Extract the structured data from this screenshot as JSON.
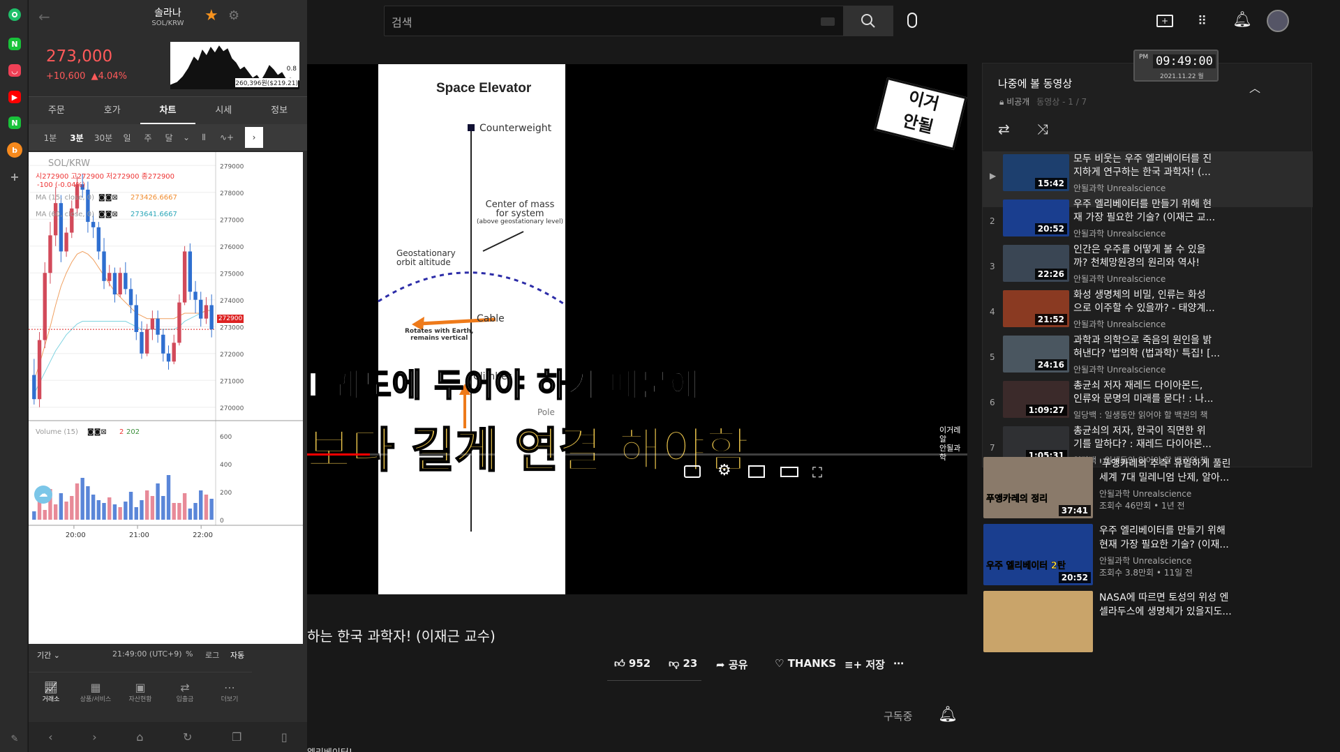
{
  "left_edge": {
    "icons": [
      "green-circle-icon",
      "naver-icon",
      "pocket-icon",
      "youtube-icon",
      "naver-icon",
      "upbit-icon",
      "add-icon",
      "pin-icon"
    ]
  },
  "upbit": {
    "coin_name": "솔라나",
    "pair": "SOL/KRW",
    "price": "273,000",
    "change": "+10,600",
    "change_pct": "▲4.04%",
    "mini_chart_labels": {
      "a": "0.8",
      "b": "260,396원($219.21)"
    },
    "tabs": [
      "주문",
      "호가",
      "차트",
      "시세",
      "정보"
    ],
    "active_tab": "차트",
    "intervals": [
      "1분",
      "3분",
      "30분",
      "일",
      "주",
      "달"
    ],
    "active_interval": "3분",
    "chart_title": "SOL/KRW",
    "ohlc": "시272900 고272900 저272900 종272900",
    "change_line": "-100 (-0.04%)",
    "ma15_label": "MA (15, close, 0)",
    "ma15_value": "273426.6667",
    "ma60_label": "MA (60, close, 0)",
    "ma60_value": "273641.6667",
    "current_price_tag": "272900",
    "y_ticks": [
      "279000",
      "278000",
      "277000",
      "276000",
      "275000",
      "274000",
      "273000",
      "272000",
      "271000",
      "270000"
    ],
    "volume_label": "Volume (15)",
    "volume_value": "2",
    "volume_value2": "202",
    "vol_ticks": [
      "600",
      "400",
      "200",
      "0"
    ],
    "x_ticks": [
      "20:00",
      "21:00",
      "22:00"
    ],
    "footer": {
      "period": "기간 ⌄",
      "time": "21:49:00 (UTC+9)",
      "pct": "%",
      "log": "로그",
      "auto": "자동"
    },
    "nav": [
      "거래소",
      "상품/서비스",
      "자산현황",
      "입출금",
      "더보기"
    ]
  },
  "chart_data": {
    "type": "candlestick",
    "title": "SOL/KRW",
    "ylim": [
      269500,
      279500
    ],
    "x_range": [
      "19:46",
      "22:16"
    ],
    "candles": [
      [
        271200,
        271800,
        270100,
        270300
      ],
      [
        270300,
        272800,
        270000,
        272500
      ],
      [
        272500,
        275400,
        272200,
        275000
      ],
      [
        275000,
        276900,
        274600,
        276400
      ],
      [
        276400,
        278200,
        276000,
        277600
      ],
      [
        277600,
        277900,
        275400,
        275800
      ],
      [
        275800,
        276700,
        275600,
        276500
      ],
      [
        276500,
        277700,
        276300,
        277400
      ],
      [
        277400,
        278600,
        277200,
        278300
      ],
      [
        278300,
        278700,
        277800,
        278100
      ],
      [
        278100,
        278400,
        276500,
        276900
      ],
      [
        276900,
        277200,
        276300,
        276700
      ],
      [
        276700,
        276900,
        275500,
        275800
      ],
      [
        275800,
        276300,
        274400,
        274700
      ],
      [
        274700,
        275300,
        274500,
        275000
      ],
      [
        275000,
        275200,
        273900,
        274200
      ],
      [
        274200,
        275200,
        274100,
        275000
      ],
      [
        275000,
        275400,
        274200,
        274400
      ],
      [
        274400,
        274800,
        273500,
        273800
      ],
      [
        273800,
        274200,
        272500,
        272800
      ],
      [
        272800,
        273200,
        271800,
        272000
      ],
      [
        272000,
        273100,
        271900,
        272900
      ],
      [
        272900,
        273600,
        272500,
        273300
      ],
      [
        273300,
        273600,
        272400,
        272700
      ],
      [
        272700,
        272900,
        271700,
        272000
      ],
      [
        272000,
        272300,
        271400,
        271700
      ],
      [
        271700,
        272700,
        271600,
        272400
      ],
      [
        272400,
        274200,
        272300,
        273900
      ],
      [
        273900,
        276000,
        273800,
        275800
      ],
      [
        275800,
        276100,
        274000,
        274300
      ],
      [
        274300,
        274700,
        273500,
        274000
      ],
      [
        274000,
        274300,
        273000,
        273300
      ],
      [
        273300,
        274100,
        273100,
        273800
      ],
      [
        273800,
        274200,
        272600,
        272900
      ]
    ],
    "ma15": [
      271000,
      271600,
      272300,
      273000,
      273800,
      274500,
      275000,
      275400,
      275700,
      275800,
      275700,
      275500,
      275200,
      274900,
      274600,
      274300,
      274100,
      273900,
      273700,
      273500,
      273400,
      273300,
      273300,
      273300,
      273300,
      273300,
      273300,
      273400,
      273500,
      273500,
      273500,
      273500,
      273600,
      273600
    ],
    "ma60": [
      270500,
      270900,
      271300,
      271700,
      272100,
      272400,
      272700,
      272900,
      273100,
      273200,
      273200,
      273200,
      273200,
      273200,
      273200,
      273200,
      273200,
      273200,
      273100,
      273000,
      272900,
      272900,
      272900,
      272900,
      272900,
      272900,
      272900,
      273000,
      273200,
      273300,
      273400,
      273500,
      273600,
      273600
    ],
    "volume": [
      60,
      150,
      70,
      220,
      110,
      190,
      130,
      170,
      260,
      300,
      240,
      180,
      140,
      120,
      160,
      110,
      90,
      130,
      200,
      90,
      140,
      210,
      170,
      260,
      170,
      320,
      120,
      120,
      190,
      80,
      120,
      210,
      180,
      150
    ]
  },
  "youtube": {
    "search_placeholder": "검색",
    "video_title": "하는 한국 과학자! (이재근 교수)",
    "likes": "952",
    "dislikes": "23",
    "share": "공유",
    "thanks": "THANKS",
    "save": "저장",
    "subscribed": "구독중",
    "desc_peek": "엘리베이터!",
    "video_frame": {
      "diagram_title": "Space Elevator",
      "counterweight": "Counterweight",
      "center_mass": "Center of mass",
      "for_system": "for system",
      "above_geo": "(above geostationary level)",
      "geo_orbit": "Geostationary",
      "orbit_alt": "orbit altitude",
      "rotates": "Rotates with Earth,",
      "remains": "remains vertical",
      "cable": "Cable",
      "climber": "Climber",
      "pole": "Pole",
      "caption1": "I 궤도에 두어야 하기 때문에",
      "caption2": "보다 길게 연결 해야함",
      "logo_line1": "이거",
      "logo_line2": "안될",
      "watermark1": "이거레알",
      "watermark2": "안될과학"
    },
    "clock": {
      "time": "09:49:00",
      "ampm": "PM",
      "date": "2021.11.22 월"
    },
    "playlist": {
      "title": "나중에 볼 동영상",
      "visibility": "비공개",
      "owner_pos": "동영상 - 1 / 7",
      "items": [
        {
          "idx": "▶",
          "title1": "모두 비웃는 우주 엘리베이터를 진",
          "title2": "지하게 연구하는 한국 과학자! (...",
          "channel": "안될과학 Unrealscience",
          "duration": "15:42"
        },
        {
          "idx": "2",
          "title1": "우주 엘리베이터를 만들기 위해 현",
          "title2": "재 가장 필요한 기술? (이재근 교...",
          "channel": "안될과학 Unrealscience",
          "duration": "20:52"
        },
        {
          "idx": "3",
          "title1": "인간은 우주를 어떻게 볼 수 있을",
          "title2": "까? 천체망원경의 원리와 역사!",
          "channel": "안될과학 Unrealscience",
          "duration": "22:26"
        },
        {
          "idx": "4",
          "title1": "화성 생명체의 비밀, 인류는 화성",
          "title2": "으로 이주할 수 있을까? - 태양계...",
          "channel": "안될과학 Unrealscience",
          "duration": "21:52"
        },
        {
          "idx": "5",
          "title1": "과학과 의학으로 죽음의 원인을 밝",
          "title2": "혀낸다? '법의학 (법과학)' 특집! [...",
          "channel": "안될과학 Unrealscience",
          "duration": "24:16"
        },
        {
          "idx": "6",
          "title1": "총균쇠 저자 재레드 다이아몬드,",
          "title2": "인류와 문명의 미래를 묻다! : 나...",
          "channel": "일당백 : 일생동안 읽어야 할 백권의 책",
          "duration": "1:09:27"
        },
        {
          "idx": "7",
          "title1": "총균쇠의 저자, 한국이 직면한 위",
          "title2": "기를 말하다? : 재레드 다이아몬...",
          "channel": "일당백 : 일생동안 읽어야 할 백권의 책",
          "duration": "1:05:31"
        }
      ]
    },
    "recommended": [
      {
        "title1": "'푸앵카레의 추측' 유일하게 풀린",
        "title2": "세계 7대 밀레니엄 난제, 알아...",
        "channel": "안될과학 Unrealscience",
        "meta": "조회수 46만회 • 1년 전",
        "duration": "37:41",
        "thumb_text": "푸앵카레의 정리"
      },
      {
        "title1": "우주 엘리베이터를 만들기 위해",
        "title2": "현재 가장 필요한 기술? (이재...",
        "channel": "안될과학 Unrealscience",
        "meta": "조회수 3.8만회 • 11일 전",
        "duration": "20:52",
        "thumb_text": "우주 엘리베이터 2탄"
      },
      {
        "title1": "NASA에 따르면 토성의 위성 엔",
        "title2": "셀라두스에 생명체가 있을지도...",
        "channel": "",
        "meta": "",
        "duration": "",
        "thumb_text": ""
      }
    ]
  }
}
